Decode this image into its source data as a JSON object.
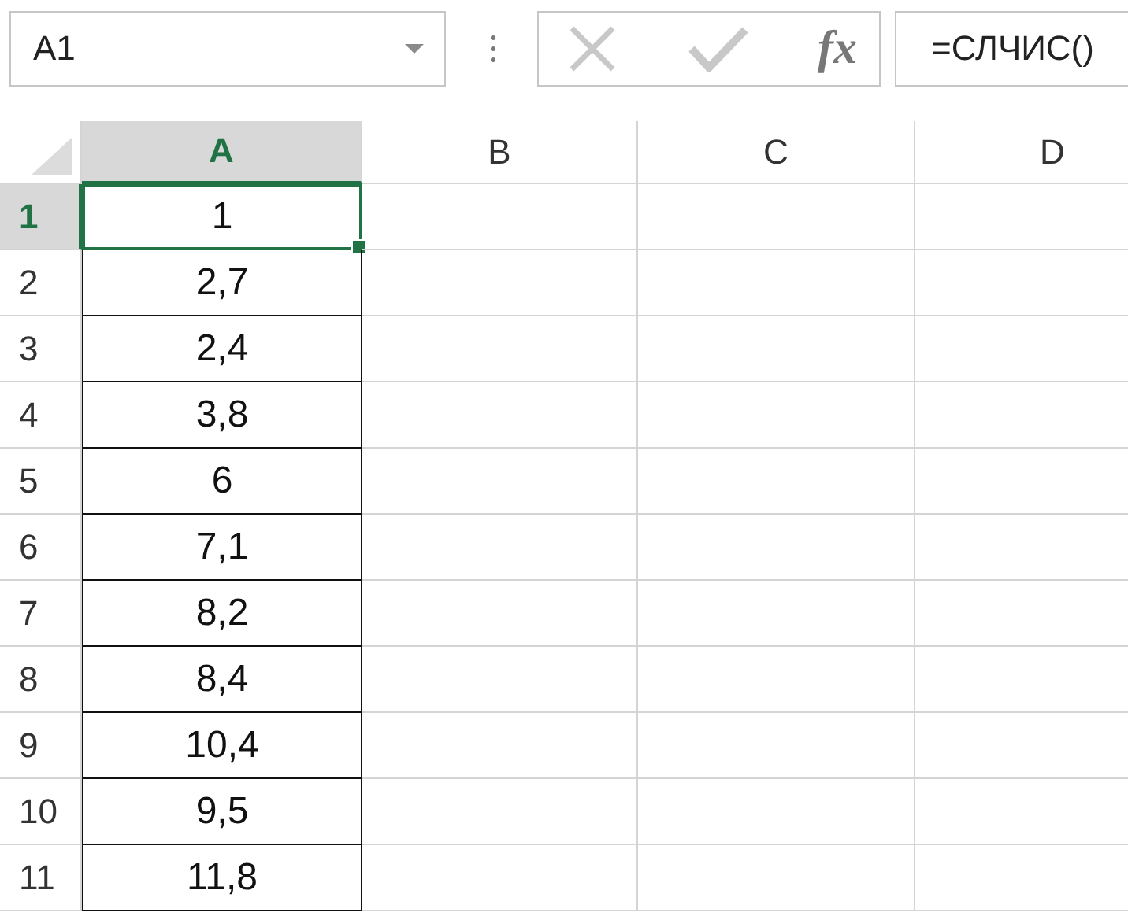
{
  "name_box": {
    "value": "A1"
  },
  "formula_bar": {
    "insert_function": "fx",
    "value": "=СЛЧИС()"
  },
  "columns": [
    {
      "label": "A",
      "selected": true
    },
    {
      "label": "B",
      "selected": false
    },
    {
      "label": "C",
      "selected": false
    },
    {
      "label": "D",
      "selected": false
    }
  ],
  "rows": [
    {
      "label": "1",
      "selected": true,
      "value": "1"
    },
    {
      "label": "2",
      "selected": false,
      "value": "2,7"
    },
    {
      "label": "3",
      "selected": false,
      "value": "2,4"
    },
    {
      "label": "4",
      "selected": false,
      "value": "3,8"
    },
    {
      "label": "5",
      "selected": false,
      "value": "6"
    },
    {
      "label": "6",
      "selected": false,
      "value": "7,1"
    },
    {
      "label": "7",
      "selected": false,
      "value": "8,2"
    },
    {
      "label": "8",
      "selected": false,
      "value": "8,4"
    },
    {
      "label": "9",
      "selected": false,
      "value": "10,4"
    },
    {
      "label": "10",
      "selected": false,
      "value": "9,5"
    },
    {
      "label": "11",
      "selected": false,
      "value": "11,8"
    }
  ]
}
